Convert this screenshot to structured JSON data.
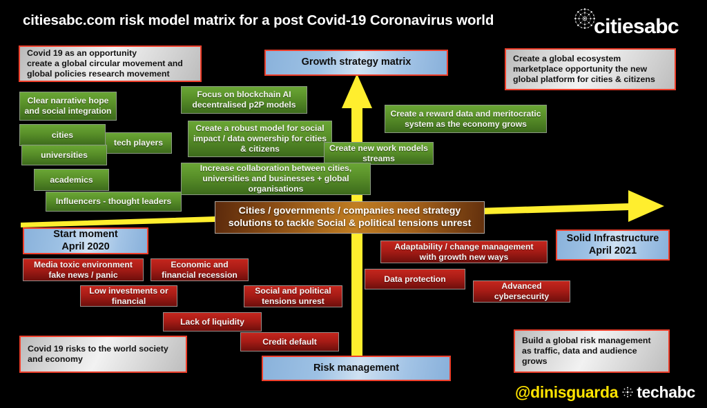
{
  "title": "citiesabc.com risk model matrix for a post Covid-19 Coronavirus world",
  "brand": {
    "logo_text": "citiesabc",
    "logo_mark": "network-mandala-icon"
  },
  "footer": {
    "handle": "@dinisguarda",
    "partner": "techabc",
    "partner_mark": "starburst-icon"
  },
  "colors": {
    "background": "#000000",
    "accent_red_outline": "#ef3f2b",
    "arrow_yellow": "#ffee2e",
    "green_box": "#599029",
    "red_box": "#a81c16",
    "blue_box": "#9dc1e4",
    "brown_box": "#c07d22",
    "grey_box": "#e0e0e0",
    "handle_yellow": "#ffe400"
  },
  "axes": {
    "vertical_arrow_label": "growth-axis-arrow-up",
    "horizontal_arrow_label": "time-axis-arrow-right"
  },
  "milestones": [
    {
      "id": "growth-strategy-matrix",
      "text": "Growth strategy matrix"
    },
    {
      "id": "start-moment",
      "text": "Start moment\nApril 2020"
    },
    {
      "id": "solid-infrastructure",
      "text": "Solid Infrastructure\nApril  2021"
    },
    {
      "id": "risk-management",
      "text": "Risk management"
    }
  ],
  "notes": [
    {
      "id": "covid-opportunity",
      "text": "Covid 19 as an opportunity\ncreate a global circular movement and\nglobal policies research movement"
    },
    {
      "id": "global-ecosystem",
      "text": "Create a global ecosystem\nmarketplace opportunity the new\nglobal platform for cities & citizens"
    },
    {
      "id": "covid-risks",
      "text": "Covid 19 risks to the world society\nand economy"
    },
    {
      "id": "build-risk-management",
      "text": "Build a global risk management\nas traffic, data and audience\ngrows"
    }
  ],
  "center_statement": "Cities / governments / companies need strategy\nsolutions to tackle Social & political tensions unrest",
  "opportunities": [
    {
      "id": "clear-narrative",
      "text": "Clear narrative hope\nand social integration"
    },
    {
      "id": "cities",
      "text": "cities"
    },
    {
      "id": "tech-players",
      "text": "tech players"
    },
    {
      "id": "universities",
      "text": "universities"
    },
    {
      "id": "academics",
      "text": "academics"
    },
    {
      "id": "influencers",
      "text": "Influencers - thought leaders"
    },
    {
      "id": "blockchain-ai",
      "text": "Focus on blockchain AI\ndecentralised p2P models"
    },
    {
      "id": "robust-model",
      "text": "Create a robust model for social\nimpact / data ownership for cities\n& citizens"
    },
    {
      "id": "reward-data",
      "text": "Create a reward data and meritocratic\nsystem as the economy grows"
    },
    {
      "id": "new-work-models",
      "text": "Create new work models\nstreams"
    },
    {
      "id": "increase-collaboration",
      "text": "Increase collaboration between cities,\nuniversities and businesses + global\norganisations"
    }
  ],
  "risks": [
    {
      "id": "media-toxic",
      "text": "Media toxic environment\nfake news / panic"
    },
    {
      "id": "economic-recession",
      "text": "Economic and\nfinancial recession"
    },
    {
      "id": "low-investments",
      "text": "Low investments or\nfinancial"
    },
    {
      "id": "social-tensions",
      "text": "Social and political\ntensions unrest"
    },
    {
      "id": "lack-of-liquidity",
      "text": "Lack of liquidity"
    },
    {
      "id": "credit-default",
      "text": "Credit default"
    },
    {
      "id": "adaptability",
      "text": "Adaptability / change management\nwith growth new ways"
    },
    {
      "id": "data-protection",
      "text": "Data protection"
    },
    {
      "id": "advanced-cybersecurity",
      "text": "Advanced\ncybersecurity"
    }
  ]
}
